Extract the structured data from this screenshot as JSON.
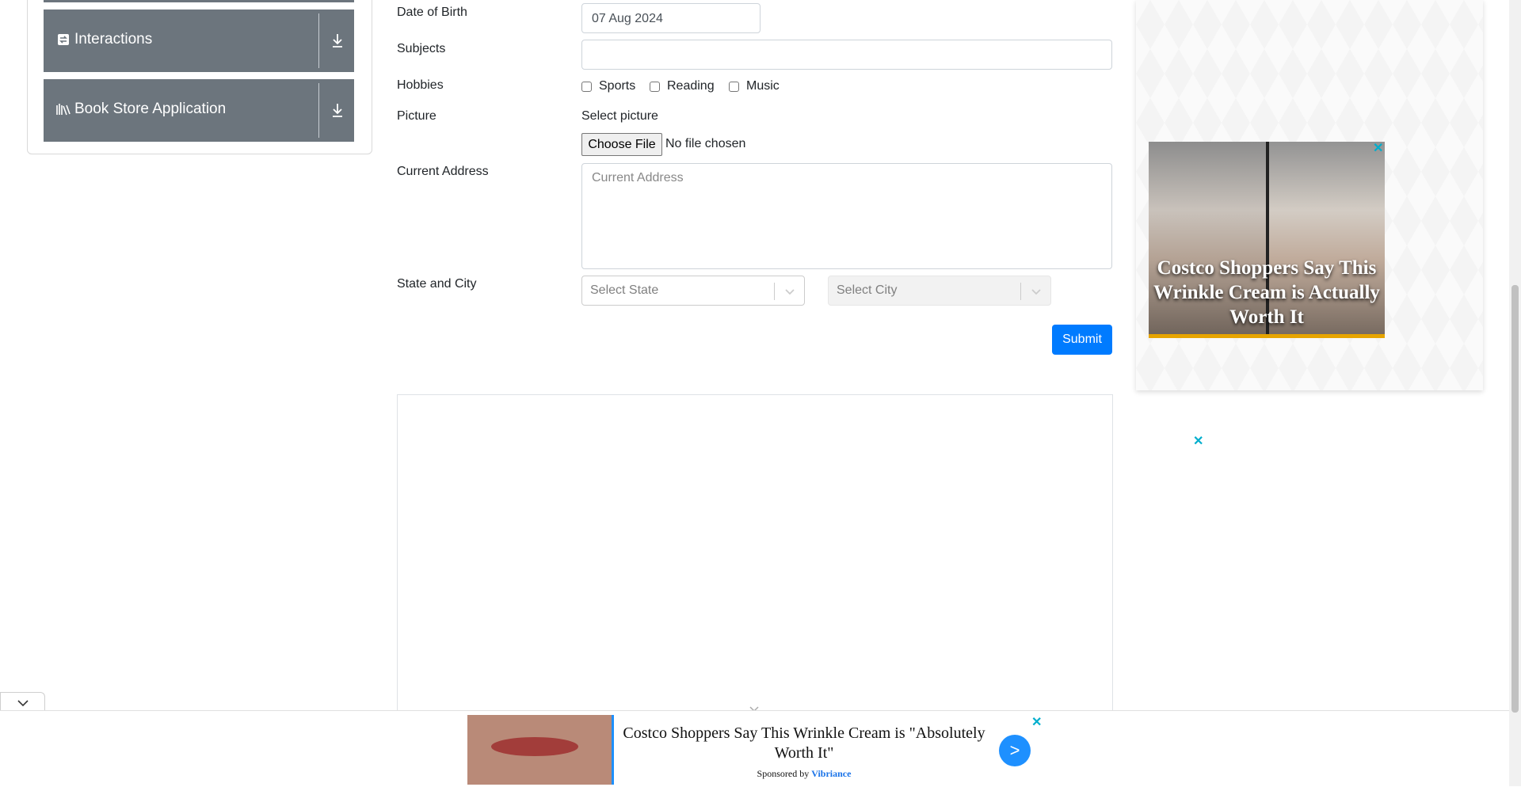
{
  "sidebar": {
    "groups": [
      {
        "label": "Interactions",
        "icon": "interactions-icon"
      },
      {
        "label": "Book Store Application",
        "icon": "book-store-icon"
      }
    ]
  },
  "form": {
    "dob": {
      "label": "Date of Birth",
      "value": "07 Aug 2024"
    },
    "subjects": {
      "label": "Subjects",
      "value": ""
    },
    "hobbies": {
      "label": "Hobbies",
      "options": [
        "Sports",
        "Reading",
        "Music"
      ]
    },
    "picture": {
      "label": "Picture",
      "select_text": "Select picture",
      "button": "Choose File",
      "status": "No file chosen"
    },
    "address": {
      "label": "Current Address",
      "placeholder": "Current Address"
    },
    "state_city": {
      "label": "State and City",
      "state_placeholder": "Select State",
      "city_placeholder": "Select City"
    },
    "submit": "Submit"
  },
  "ads": {
    "side": {
      "headline": "Costco Shoppers Say This Wrinkle Cream is Actually Worth It",
      "close": "✕"
    },
    "inline_close": "✕",
    "bottom": {
      "headline": "Costco Shoppers Say This Wrinkle Cream is \"Absolutely Worth It\"",
      "sponsored_by": "Sponsored by",
      "brand": "Vibriance",
      "go": ">",
      "close": "✕"
    }
  },
  "colors": {
    "primary": "#007bff",
    "sidebar_group": "#6c757d",
    "ad_close": "#00aecd"
  }
}
